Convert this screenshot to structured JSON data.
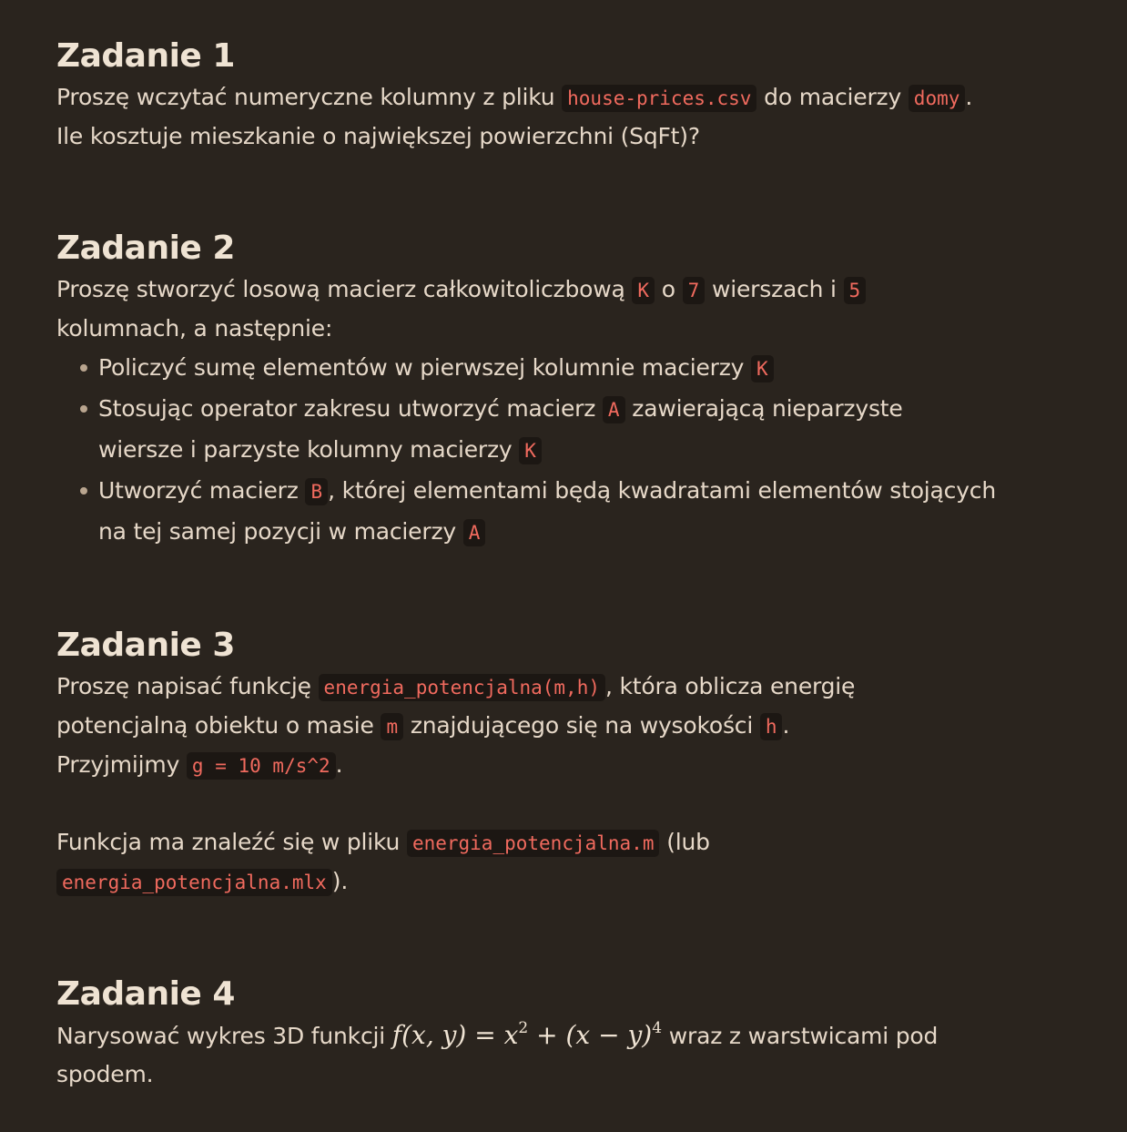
{
  "tasks": [
    {
      "title": "Zadanie 1",
      "lines": [
        {
          "t1": "Proszę wczytać numeryczne kolumny z pliku ",
          "c1": "house-prices.csv",
          "t2": " do macierzy ",
          "c2": "domy",
          "t3": "."
        },
        {
          "t1": "Ile kosztuje mieszkanie o największej powierzchni (SqFt)?"
        }
      ]
    },
    {
      "title": "Zadanie 2",
      "lines": [
        {
          "t1": "Proszę stworzyć losową macierz całkowitoliczbową ",
          "c1": "K",
          "t2": " o ",
          "c2": "7",
          "t3": " wierszach i ",
          "c3": "5"
        },
        {
          "t1": "kolumnach, a następnie:"
        }
      ],
      "bullets": [
        {
          "t1": "Policzyć sumę elementów w pierwszej kolumnie macierzy ",
          "c1": "K"
        },
        {
          "t1": "Stosując operator zakresu utworzyć macierz ",
          "c1": "A",
          "t2": " zawierającą nieparzyste",
          "t3": "wiersze i parzyste kolumny macierzy ",
          "c2": "K"
        },
        {
          "t1": "Utworzyć macierz ",
          "c1": "B",
          "t2": ", której elementami będą kwadratami elementów stojących",
          "t3": "na tej samej pozycji w macierzy ",
          "c2": "A"
        }
      ]
    },
    {
      "title": "Zadanie 3",
      "lines": [
        {
          "t1": "Proszę napisać funkcję ",
          "c1": "energia_potencjalna(m,h)",
          "t2": ", która oblicza energię"
        },
        {
          "t1": "potencjalną obiektu o masie ",
          "c1": "m",
          "t2": " znajdującego się na wysokości ",
          "c2": "h",
          "t3": "."
        },
        {
          "t1": "Przyjmijmy ",
          "c1": "g = 10 m/s^2",
          "t2": "."
        },
        {
          "t1": "Funkcja ma znaleźć się w pliku ",
          "c1": "energia_potencjalna.m",
          "t2": " (lub"
        },
        {
          "c1": "energia_potencjalna.mlx",
          "t1": ")."
        }
      ]
    },
    {
      "title": "Zadanie 4",
      "lines": [
        {
          "t1": "Narysować wykres 3D funkcji ",
          "m1": "f(x, y) = x",
          "m_exp1": "2",
          "m2": " + (x − y)",
          "m_exp2": "4",
          "t2": " wraz z warstwicami pod"
        },
        {
          "t1": "spodem."
        }
      ]
    }
  ]
}
